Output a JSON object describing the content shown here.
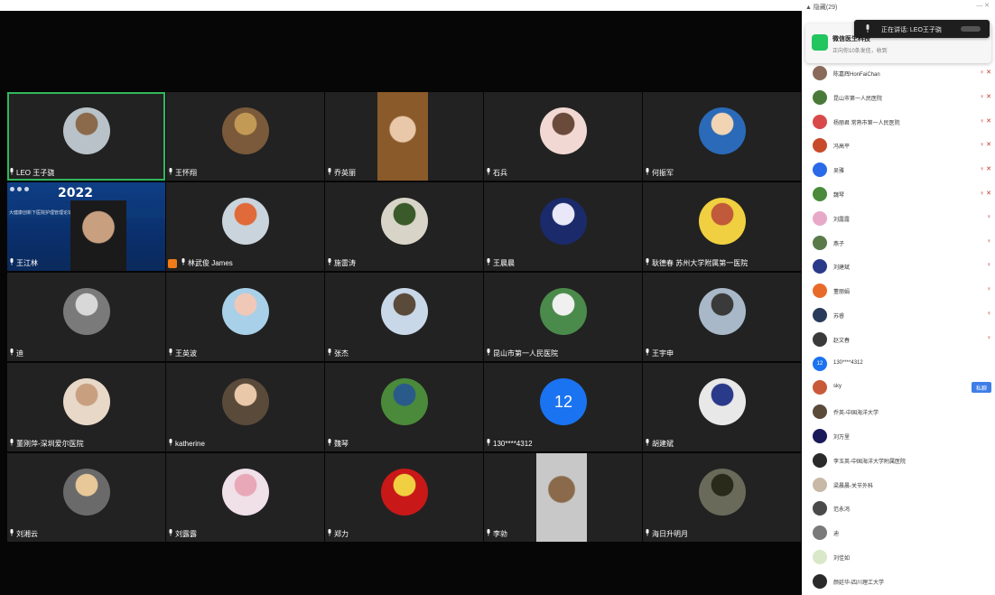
{
  "active_speaker": {
    "label": "正在讲话: LEO王子骁"
  },
  "panel": {
    "title": "▲ 隐藏(29)",
    "controls": "— ✕",
    "notification": {
      "title": "微信医生科技",
      "subtitle": "正向你10条发信，收到"
    }
  },
  "tiles": [
    {
      "name": "LEO 王子骁",
      "active": true,
      "kind": "avatar",
      "color": "#b8c2c8",
      "color2": "#8a6a4a"
    },
    {
      "name": "王怀翔",
      "kind": "avatar",
      "color": "#7a5a3a",
      "color2": "#c29a55"
    },
    {
      "name": "乔英丽",
      "kind": "video",
      "color": "#8a5a2a",
      "color2": "#e8c8a8"
    },
    {
      "name": "石兵",
      "kind": "avatar",
      "color": "#f2d8d2",
      "color2": "#6a4a3a"
    },
    {
      "name": "何振军",
      "kind": "avatar",
      "color": "#2a6ab8",
      "color2": "#f0d4b4"
    },
    {
      "name": "王江林",
      "kind": "slide",
      "slide_year": "2022",
      "slide_banner": "大健康创新下医院护理管理论坛"
    },
    {
      "name": "林武俊 James",
      "kind": "avatar",
      "badge": true,
      "color": "#c9d4dc",
      "color2": "#e06a3a"
    },
    {
      "name": "施雷涛",
      "kind": "avatar",
      "color": "#d8d4c8",
      "color2": "#3a5a2a"
    },
    {
      "name": "王晨晨",
      "kind": "avatar",
      "color": "#1a2a6a",
      "color2": "#e8e8f8"
    },
    {
      "name": "耿德春 苏州大学附属第一医院",
      "kind": "avatar",
      "color": "#f0d040",
      "color2": "#c05a3a"
    },
    {
      "name": "迪",
      "kind": "avatar",
      "color": "#7a7a7a",
      "color2": "#d8d8d8"
    },
    {
      "name": "王英波",
      "kind": "avatar",
      "color": "#a8d0e8",
      "color2": "#f0c8b8"
    },
    {
      "name": "张杰",
      "kind": "avatar",
      "color": "#c8d8e8",
      "color2": "#5a4a3a"
    },
    {
      "name": "昆山市第一人民医院",
      "kind": "avatar",
      "color": "#4a8a4a",
      "color2": "#f0f0f0"
    },
    {
      "name": "王宇申",
      "kind": "avatar",
      "color": "#a8b8c8",
      "color2": "#3a3a3a"
    },
    {
      "name": "董刚萍-深圳爱尔医院",
      "kind": "avatar",
      "color": "#e8d8c8",
      "color2": "#c8a080"
    },
    {
      "name": "katherine",
      "kind": "avatar",
      "color": "#5a4a3a",
      "color2": "#e8c8a8"
    },
    {
      "name": "魏琴",
      "kind": "avatar",
      "color": "#4a8a3a",
      "color2": "#2a5a8a"
    },
    {
      "name": "130****4312",
      "kind": "number",
      "number": "12"
    },
    {
      "name": "胡建斌",
      "kind": "avatar",
      "color": "#e8e8e8",
      "color2": "#2a3a8a"
    },
    {
      "name": "刘湘云",
      "kind": "avatar",
      "color": "#6a6a6a",
      "color2": "#e8c898"
    },
    {
      "name": "刘露露",
      "kind": "avatar",
      "color": "#f0e0e8",
      "color2": "#e8a8b8"
    },
    {
      "name": "郑力",
      "kind": "avatar",
      "color": "#c81818",
      "color2": "#f0d040"
    },
    {
      "name": "李勍",
      "kind": "video",
      "color": "#c8c8c8",
      "color2": "#8a6a4a"
    },
    {
      "name": "海日升明月",
      "kind": "avatar",
      "color": "#6a6a5a",
      "color2": "#2a2a1a"
    }
  ],
  "participants": [
    {
      "name": "陈嘉辉HonFaiChan",
      "color": "#8a6a5a",
      "icons": "♀ ✕"
    },
    {
      "name": "昆山市第一人民医院",
      "color": "#4a7a3a",
      "icons": "♀ ✕"
    },
    {
      "name": "杨丽君 常熟市第一人民医院",
      "color": "#d84a4a",
      "icons": "♀ ✕"
    },
    {
      "name": "冯高平",
      "color": "#c84a2a",
      "icons": "♀ ✕"
    },
    {
      "name": "吴雅",
      "color": "#2a6ae8",
      "icons": "♀ ✕"
    },
    {
      "name": "魏琴",
      "color": "#4a8a3a",
      "icons": "♀ ✕"
    },
    {
      "name": "刘露露",
      "color": "#e8a8c8",
      "icons": "♀"
    },
    {
      "name": "燕子",
      "color": "#5a7a4a",
      "icons": "♀"
    },
    {
      "name": "刘建斌",
      "color": "#2a3a8a",
      "icons": "♀"
    },
    {
      "name": "董丽娟",
      "color": "#e86a2a",
      "icons": "♀"
    },
    {
      "name": "苏睿",
      "color": "#2a3a5a",
      "icons": "♀"
    },
    {
      "name": "赵文春",
      "color": "#3a3a3a",
      "icons": "♀"
    },
    {
      "name": "130****4312",
      "color": "#1a73f0",
      "number": "12"
    },
    {
      "name": "sky",
      "color": "#c85a3a",
      "button": "私聊"
    },
    {
      "name": "乔英-中国海洋大学",
      "color": "#5a4a3a"
    },
    {
      "name": "刘万里",
      "color": "#1a1a5a"
    },
    {
      "name": "李玉英-中国海洋大学附属医院",
      "color": "#2a2a2a"
    },
    {
      "name": "梁晨晨-关节外科",
      "color": "#c8b8a8"
    },
    {
      "name": "范永鸿",
      "color": "#4a4a4a"
    },
    {
      "name": "迪",
      "color": "#7a7a7a"
    },
    {
      "name": "刘佳如",
      "color": "#d8e8c8"
    },
    {
      "name": "颜廷华-四川理工大学",
      "color": "#2a2a2a"
    }
  ]
}
